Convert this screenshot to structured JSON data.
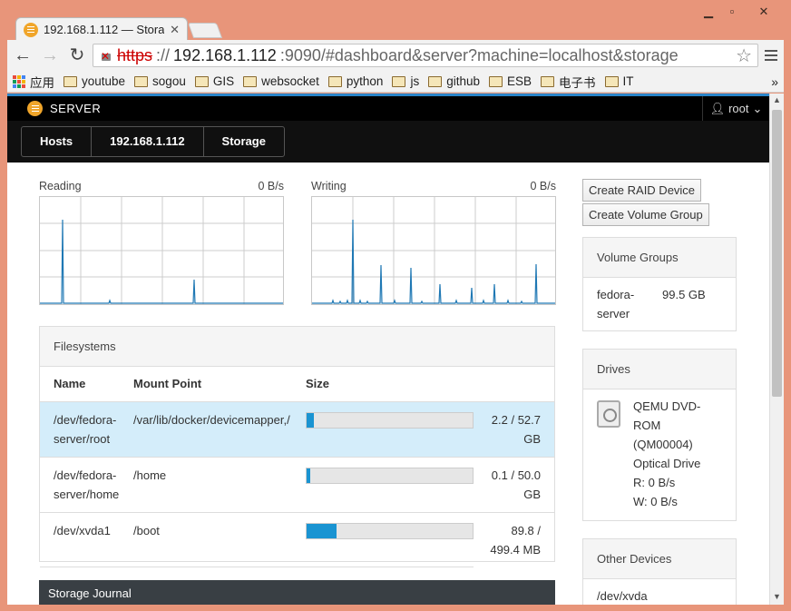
{
  "browser": {
    "tab_title": "192.168.1.112 — Stora",
    "url_scheme": "https",
    "url_sep": "://",
    "url_host": "192.168.1.112",
    "url_rest": ":9090/#dashboard&server?machine=localhost&storage",
    "bookmarks": [
      "应用",
      "youtube",
      "sogou",
      "GIS",
      "websocket",
      "python",
      "js",
      "github",
      "ESB",
      "电子书",
      "IT"
    ],
    "bookmarks_more": "»"
  },
  "app": {
    "brand": "SERVER",
    "user": "root",
    "breadcrumbs": [
      "Hosts",
      "192.168.1.112",
      "Storage"
    ]
  },
  "graphs": {
    "reading": {
      "label": "Reading",
      "value": "0 B/s"
    },
    "writing": {
      "label": "Writing",
      "value": "0 B/s"
    }
  },
  "filesystems": {
    "title": "Filesystems",
    "columns": [
      "Name",
      "Mount Point",
      "Size"
    ],
    "rows": [
      {
        "name": "/dev/fedora-server/root",
        "mount": "/var/lib/docker/devicemapper,/",
        "size": "2.2 / 52.7 GB",
        "fraction": 0.042
      },
      {
        "name": "/dev/fedora-server/home",
        "mount": "/home",
        "size": "0.1 / 50.0 GB",
        "fraction": 0.02
      },
      {
        "name": "/dev/xvda1",
        "mount": "/boot",
        "size": "89.8 / 499.4 MB",
        "fraction": 0.18
      }
    ]
  },
  "journal": {
    "title": "Storage Journal"
  },
  "actions": {
    "create_raid": "Create RAID Device",
    "create_vg": "Create Volume Group"
  },
  "volume_groups": {
    "title": "Volume Groups",
    "items": [
      {
        "name": "fedora-server",
        "size": "99.5 GB"
      }
    ]
  },
  "drives": {
    "title": "Drives",
    "items": [
      {
        "name": "QEMU DVD-ROM (QM00004)",
        "type": "Optical Drive",
        "read": "R: 0 B/s",
        "write": "W: 0 B/s"
      }
    ]
  },
  "other_devices": {
    "title": "Other Devices",
    "items": [
      "/dev/xvda"
    ]
  },
  "colors": {
    "accent": "#2a85c9",
    "bar_fill": "#1a94d2",
    "selected_row": "#d4edfa",
    "chart_line": "#1f78b4"
  }
}
